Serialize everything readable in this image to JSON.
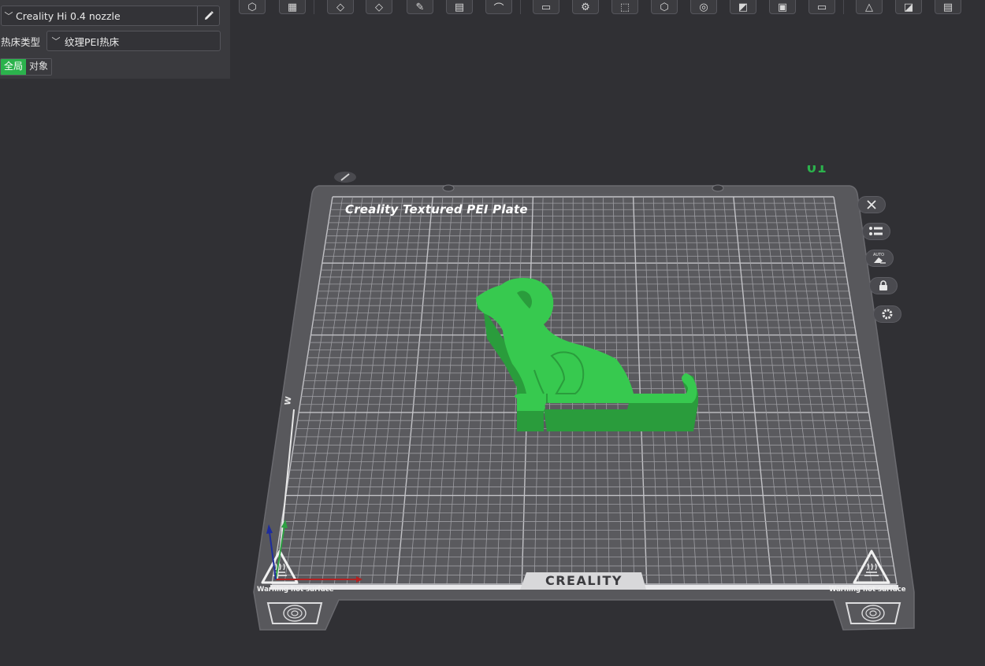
{
  "settings_panel": {
    "printer": {
      "name": "Creality Hi 0.4 nozzle",
      "dropdown_icon": "chevron-down-icon",
      "edit_icon": "pencil-icon"
    },
    "bed_type": {
      "label": "热床类型",
      "value": "纹理PEI热床"
    },
    "scope_tabs": [
      {
        "label": "全局",
        "active": true
      },
      {
        "label": "对象",
        "active": false
      }
    ]
  },
  "toolbar": {
    "items": [
      "view-cube-icon",
      "grid-icon",
      "orient-icon",
      "arrange-icon",
      "auto-place-icon",
      "layout-icon",
      "seam-icon",
      "split-objects-icon",
      "settings-icon",
      "bounding-box-icon",
      "cut-icon",
      "support-paint-icon",
      "measure-icon",
      "color-paint-icon",
      "assembly-icon",
      "text-icon",
      "slice-view-icon",
      "shape-icon",
      "layers-icon"
    ]
  },
  "viewport": {
    "plate": {
      "title": "Creality Textured PEI Plate",
      "number": "01",
      "brand": "CREALITY",
      "warning_left": "Warning hot surface",
      "warning_right": "Warning hot surface",
      "model_color": "#37c94f",
      "edit_icon": "pencil-icon"
    },
    "plate_buttons": [
      {
        "name": "close-plate-button",
        "icon": "close-icon"
      },
      {
        "name": "plate-settings-list-button",
        "icon": "list-icon"
      },
      {
        "name": "auto-orient-button",
        "icon": "auto-eraser-icon"
      },
      {
        "name": "lock-plate-button",
        "icon": "lock-icon"
      },
      {
        "name": "plate-gear-button",
        "icon": "gear-icon"
      }
    ],
    "colors": {
      "background": "#303034",
      "plate": "#58585c",
      "grid": "#a5a5a9",
      "accent": "#2bb24c"
    }
  }
}
